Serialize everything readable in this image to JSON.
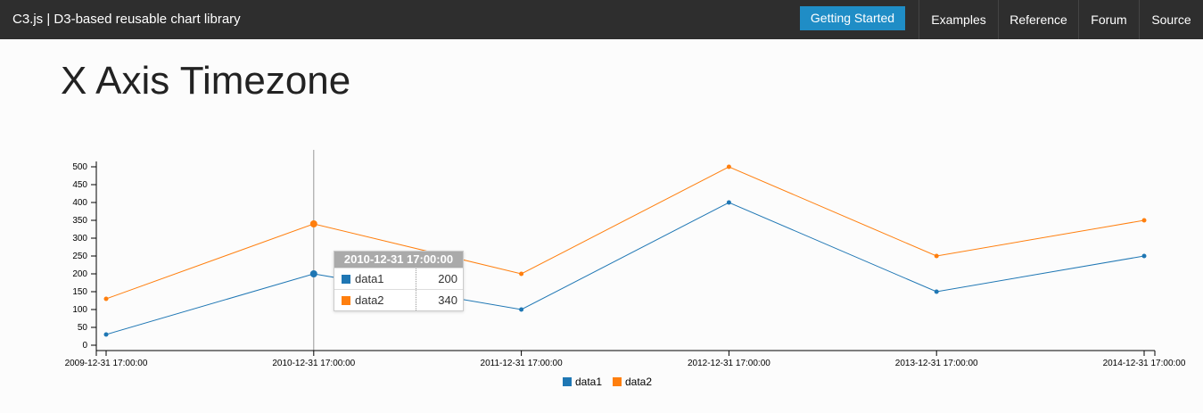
{
  "nav": {
    "brand": "C3.js | D3-based reusable chart library",
    "getting_started": "Getting Started",
    "items": [
      "Examples",
      "Reference",
      "Forum",
      "Source"
    ]
  },
  "page": {
    "title": "X Axis Timezone"
  },
  "colors": {
    "data1": "#1f77b4",
    "data2": "#ff7f0e",
    "accent": "#1f8dc6",
    "navbar": "#2e2e2e"
  },
  "chart_data": {
    "type": "line",
    "x": [
      "2009-12-31 17:00:00",
      "2010-12-31 17:00:00",
      "2011-12-31 17:00:00",
      "2012-12-31 17:00:00",
      "2013-12-31 17:00:00",
      "2014-12-31 17:00:00"
    ],
    "series": [
      {
        "name": "data1",
        "values": [
          30,
          200,
          100,
          400,
          150,
          250
        ]
      },
      {
        "name": "data2",
        "values": [
          130,
          340,
          200,
          500,
          250,
          350
        ]
      }
    ],
    "yticks": [
      0,
      50,
      100,
      150,
      200,
      250,
      300,
      350,
      400,
      450,
      500
    ],
    "ylim": [
      0,
      515
    ],
    "legend": "bottom-center",
    "grid": false
  },
  "tooltip": {
    "title": "2010-12-31 17:00:00",
    "rows": [
      {
        "name": "data1",
        "value": "200"
      },
      {
        "name": "data2",
        "value": "340"
      }
    ]
  }
}
